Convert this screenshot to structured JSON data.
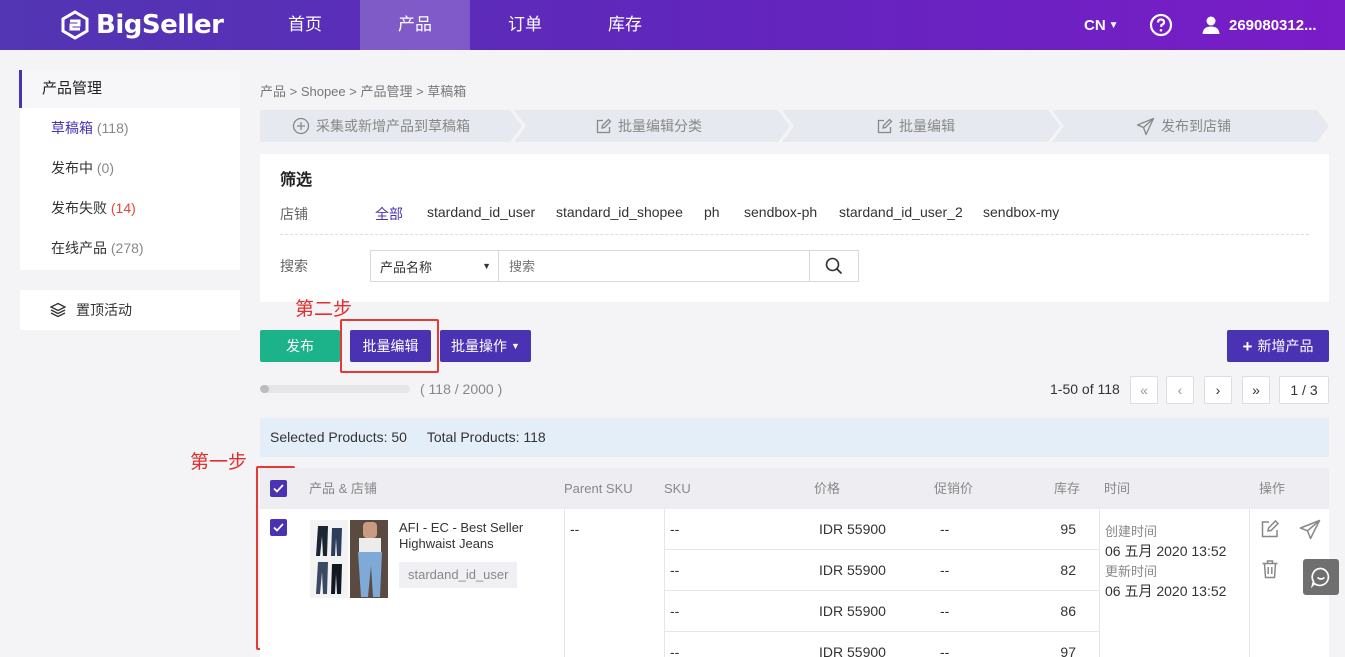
{
  "header": {
    "brand": "BigSeller",
    "nav": [
      "首页",
      "产品",
      "订单",
      "库存"
    ],
    "lang": "CN",
    "user": "269080312..."
  },
  "sidebar": {
    "section_title": "产品管理",
    "items": [
      {
        "label": "草稿箱",
        "count": "(118)"
      },
      {
        "label": "发布中",
        "count": "(0)"
      },
      {
        "label": "发布失败",
        "count": "(14)"
      },
      {
        "label": "在线产品",
        "count": "(278)"
      }
    ],
    "pinned": "置顶活动"
  },
  "breadcrumb": "产品 > Shopee > 产品管理 > 草稿箱",
  "steps": [
    "采集或新增产品到草稿箱",
    "批量编辑分类",
    "批量编辑",
    "发布到店铺"
  ],
  "filter": {
    "title": "筛选",
    "store_label": "店铺",
    "stores": [
      "全部",
      "stardand_id_user",
      "standard_id_shopee",
      "ph",
      "sendbox-ph",
      "stardand_id_user_2",
      "sendbox-my"
    ],
    "search_label": "搜索",
    "search_field": "产品名称",
    "search_placeholder": "搜索"
  },
  "annotations": {
    "step2": "第二步",
    "step1": "第一步"
  },
  "actions": {
    "publish": "发布",
    "batch_edit": "批量编辑",
    "batch_ops": "批量操作",
    "add_product": "新增产品"
  },
  "quota": {
    "text": "( 118 / 2000 )",
    "fraction": 0.059
  },
  "pagination": {
    "range": "1-50 of 118",
    "page": "1 / 3"
  },
  "selection": {
    "selected": "Selected Products: 50",
    "total": "Total Products: 118"
  },
  "table": {
    "headers": [
      "产品 & 店铺",
      "Parent SKU",
      "SKU",
      "价格",
      "促销价",
      "库存",
      "时间",
      "操作"
    ],
    "product": {
      "name_line1": "AFI - EC - Best Seller",
      "name_line2": "Highwaist Jeans",
      "store": "stardand_id_user",
      "parent_sku": "--",
      "created_label": "创建时间",
      "created": "06 五月 2020 13:52",
      "updated_label": "更新时间",
      "updated": "06 五月 2020 13:52"
    },
    "variants": [
      {
        "sku": "--",
        "price": "IDR 55900",
        "promo": "--",
        "stock": "95"
      },
      {
        "sku": "--",
        "price": "IDR 55900",
        "promo": "--",
        "stock": "82"
      },
      {
        "sku": "--",
        "price": "IDR 55900",
        "promo": "--",
        "stock": "86"
      },
      {
        "sku": "--",
        "price": "IDR 55900",
        "promo": "--",
        "stock": "97"
      }
    ]
  },
  "colors": {
    "brand": "#4a33b3",
    "publish": "#1db38a",
    "danger": "#e53935"
  }
}
